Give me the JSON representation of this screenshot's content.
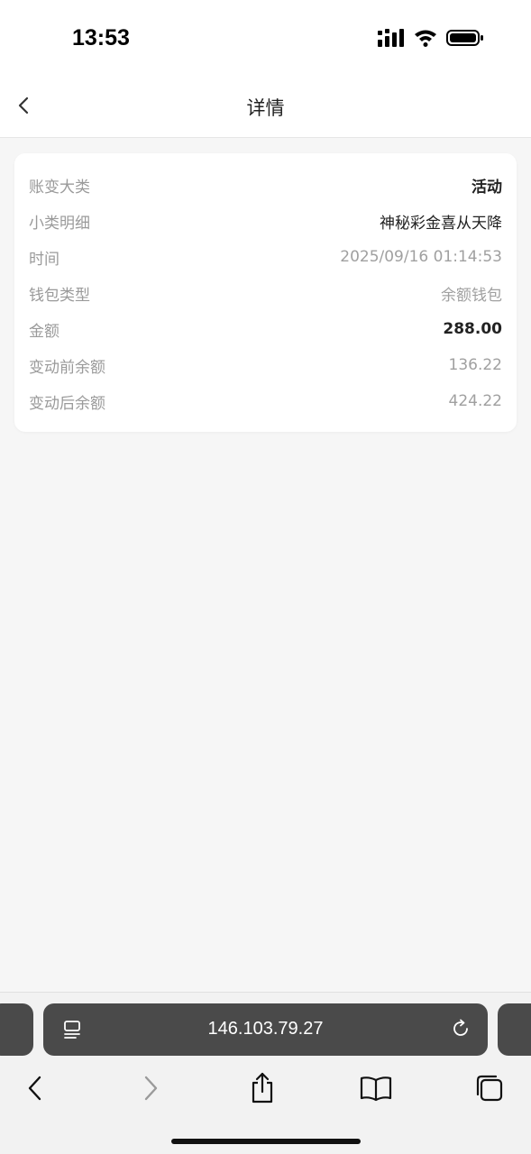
{
  "status_bar": {
    "time": "13:53",
    "icons": [
      "cellular-signal-icon",
      "wifi-icon",
      "battery-icon"
    ]
  },
  "header": {
    "back_icon": "chevron-left-icon",
    "title": "详情"
  },
  "details": {
    "rows": [
      {
        "label": "账变大类",
        "value": "活动"
      },
      {
        "label": "小类明细",
        "value": "神秘彩金喜从天降"
      },
      {
        "label": "时间",
        "value": "2025/09/16 01:14:53"
      },
      {
        "label": "钱包类型",
        "value": "余额钱包"
      },
      {
        "label": "金额",
        "value": "288.00"
      },
      {
        "label": "变动前余额",
        "value": "136.22"
      },
      {
        "label": "变动后余额",
        "value": "424.22"
      }
    ]
  },
  "browser": {
    "url": "146.103.79.27",
    "icons": [
      "page-menu-icon",
      "reload-icon"
    ],
    "toolbar": [
      "back-icon",
      "forward-icon",
      "share-icon",
      "bookmarks-icon",
      "tabs-icon"
    ]
  },
  "colors": {
    "background": "#f6f6f6",
    "card": "#ffffff",
    "label": "#9a9a9a",
    "emphasis": "#222222",
    "url_bar": "#4a4a4a"
  }
}
